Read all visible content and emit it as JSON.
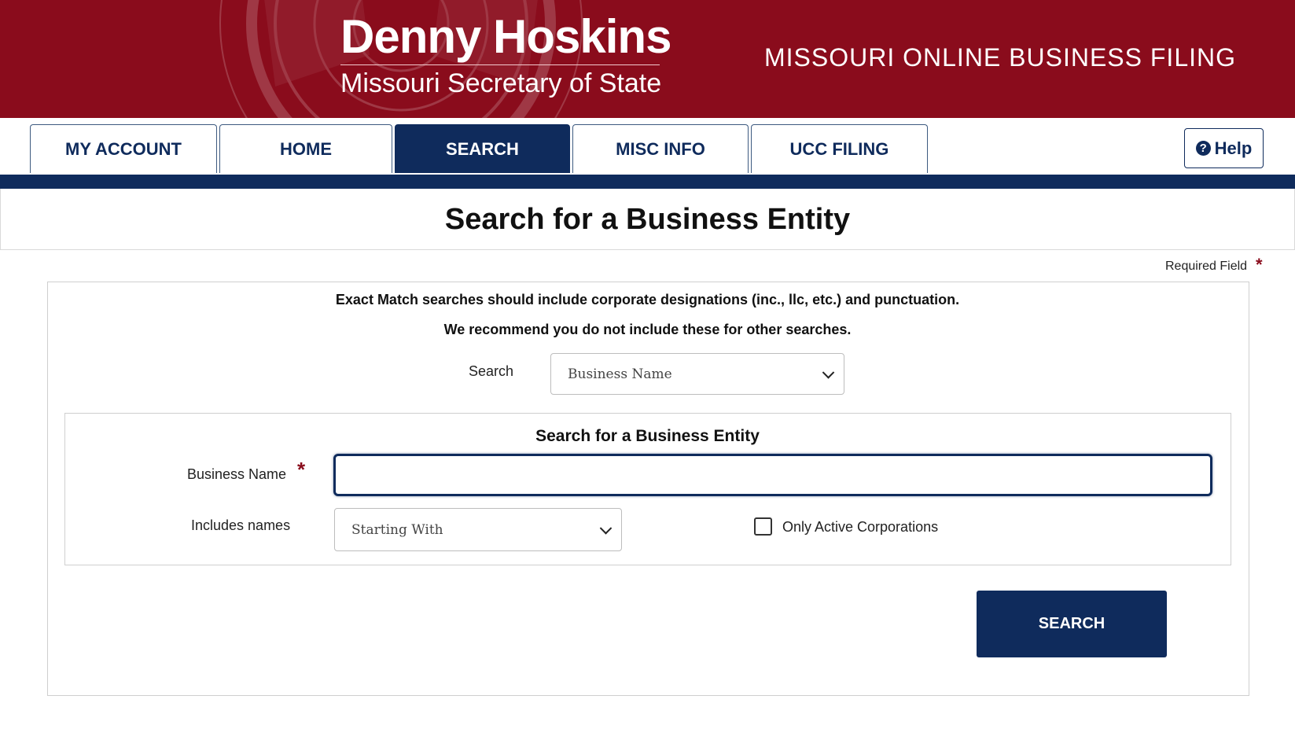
{
  "header": {
    "official_name": "Denny Hoskins",
    "official_title": "Missouri Secretary of State",
    "site_title": "MISSOURI ONLINE BUSINESS FILING"
  },
  "nav": {
    "tabs": [
      {
        "label": "MY ACCOUNT",
        "active": false
      },
      {
        "label": "HOME",
        "active": false
      },
      {
        "label": "SEARCH",
        "active": true
      },
      {
        "label": "MISC INFO",
        "active": false
      },
      {
        "label": "UCC FILING",
        "active": false
      }
    ],
    "help_label": "Help",
    "help_icon": "question-circle-icon"
  },
  "page": {
    "title": "Search for a Business Entity",
    "required_note": "Required Field",
    "required_marker": "*",
    "note_exact_match": "Exact Match searches should include corporate designations (inc., llc, etc.) and punctuation.",
    "note_recommend": "We recommend you do not include these for other searches."
  },
  "form": {
    "search_label": "Search",
    "search_type_value": "Business Name",
    "section_title": "Search for a Business Entity",
    "business_name_label": "Business Name",
    "business_name_value": "",
    "includes_label": "Includes names",
    "includes_value": "Starting With",
    "active_only_label": "Only Active Corporations",
    "active_only_checked": false,
    "submit_label": "SEARCH"
  },
  "colors": {
    "banner": "#8a0c1c",
    "navy": "#0f2b5c",
    "required_star": "#8a0c1c"
  }
}
